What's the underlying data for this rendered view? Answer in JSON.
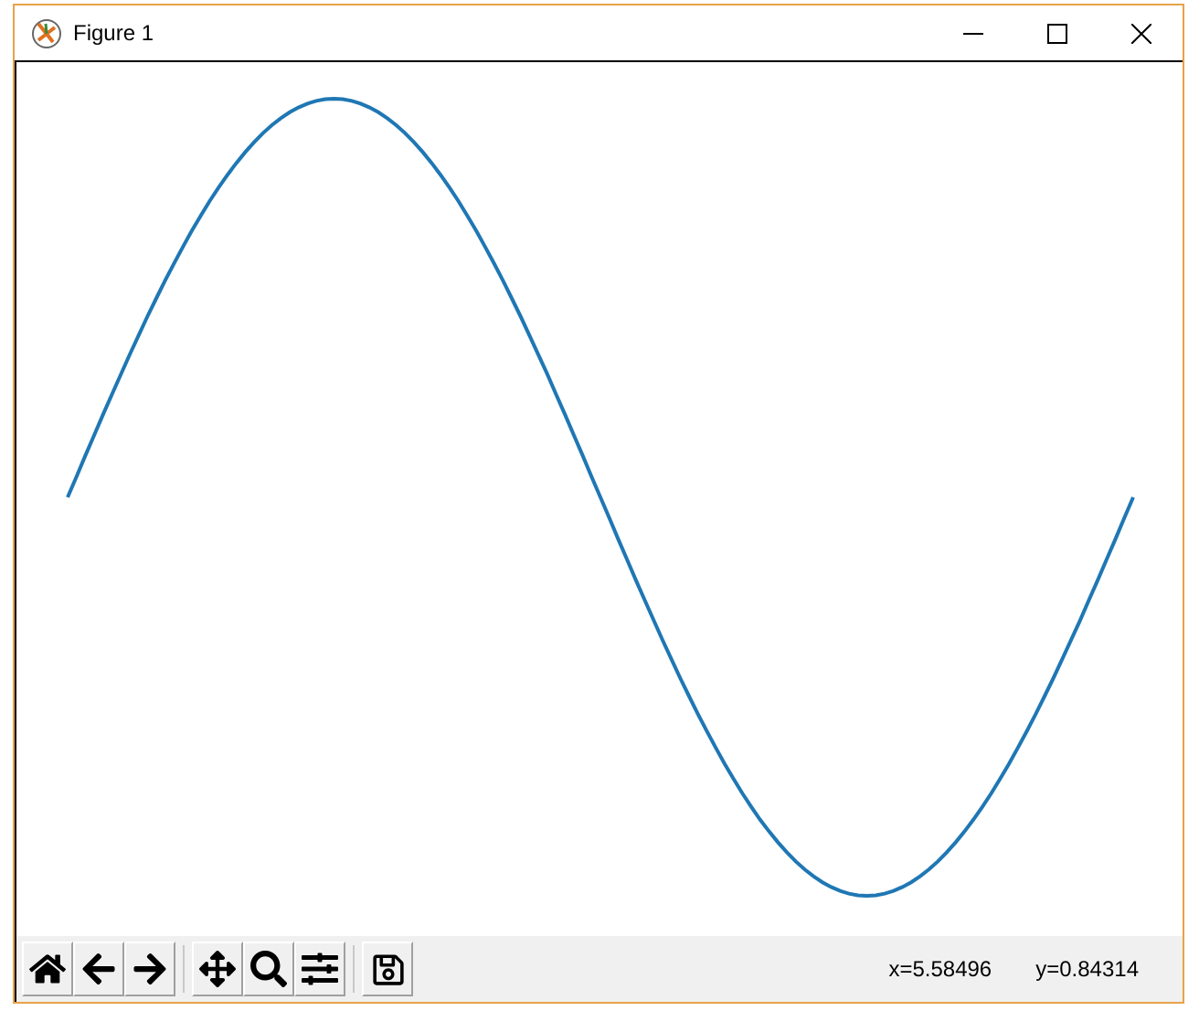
{
  "window": {
    "title": "Figure 1"
  },
  "toolbar": {
    "buttons": [
      {
        "kind": "home"
      },
      {
        "kind": "back"
      },
      {
        "kind": "forward"
      },
      {
        "kind": "separator"
      },
      {
        "kind": "pan"
      },
      {
        "kind": "zoom"
      },
      {
        "kind": "configure"
      },
      {
        "kind": "separator"
      },
      {
        "kind": "save"
      }
    ]
  },
  "status": {
    "x_reading": "x=5.58496",
    "y_reading": "y=0.84314"
  }
}
